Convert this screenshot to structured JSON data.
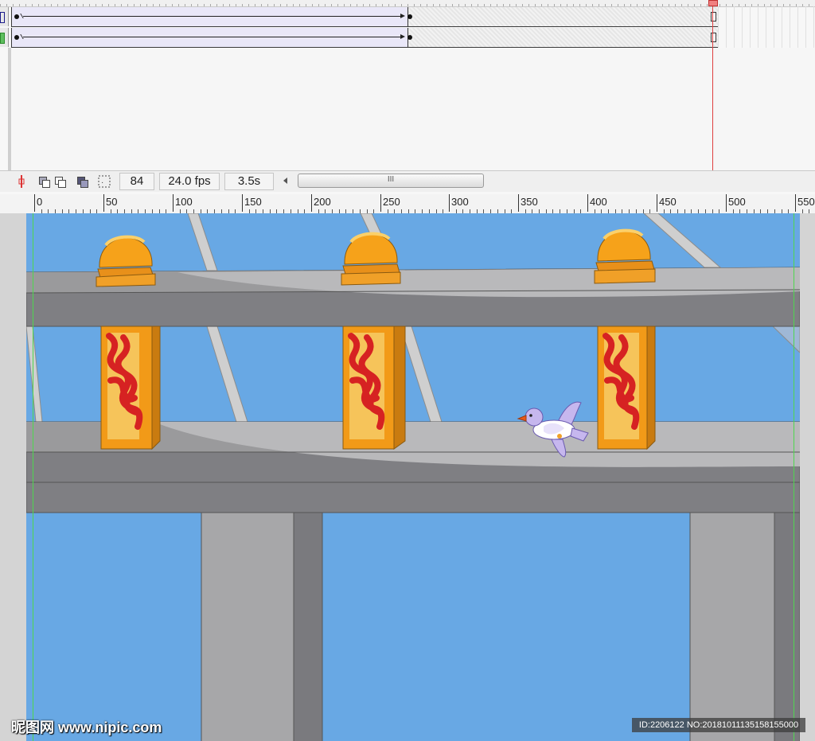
{
  "timeline": {
    "current_frame": "84",
    "frame_rate": "24.0 fps",
    "elapsed_time": "3.5s",
    "scroll_thumb_grip": "III",
    "layers": [
      {
        "outline_color": "#1a1a8a"
      },
      {
        "outline_color": "#2a8a2a"
      }
    ]
  },
  "ruler": {
    "labels": [
      "0",
      "50",
      "100",
      "150",
      "200",
      "250",
      "300",
      "350",
      "400",
      "450",
      "500",
      "550"
    ]
  },
  "colors": {
    "sky": "#68a8e4",
    "beam_light": "#b8b8b8",
    "beam_dark": "#7a7a7e",
    "pillar_orange": "#f29a18",
    "pattern_red": "#d62222",
    "bird_lavender": "#c6b7ee",
    "guide_green": "#4fd64f",
    "playhead_red": "#e04040"
  },
  "watermark": {
    "brand": "昵图网 www.nipic.com",
    "id_text": "ID:2206122 NO:20181011135158155000"
  }
}
